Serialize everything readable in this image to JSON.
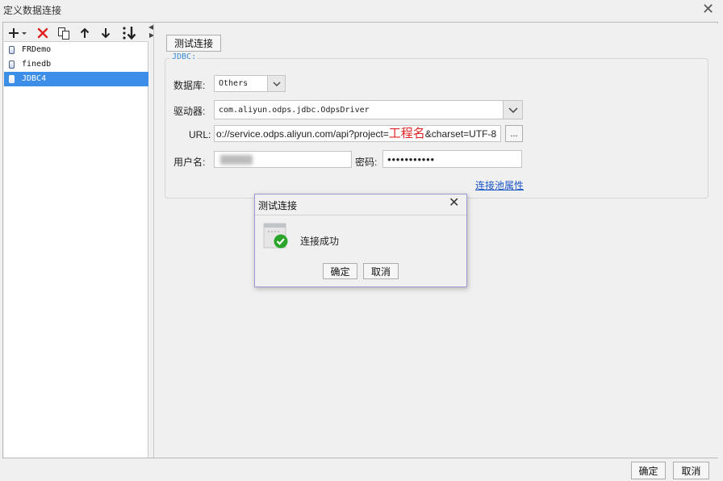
{
  "window": {
    "title": "定义数据连接",
    "close_glyph": "✕"
  },
  "toolbar": {
    "add_icon": "plus-icon",
    "delete_icon": "delete-icon",
    "copy_icon": "copy-icon",
    "up_icon": "arrow-up-icon",
    "down_icon": "arrow-down-icon",
    "sort_icon": "sort-icon",
    "accent_red": "#e02020"
  },
  "connections": {
    "items": [
      {
        "label": "FRDemo",
        "selected": false
      },
      {
        "label": "finedb",
        "selected": false
      },
      {
        "label": "JDBC4",
        "selected": true
      }
    ]
  },
  "splitter": {
    "left_glyph": "◀",
    "right_glyph": "▶"
  },
  "main": {
    "test_button": "测试连接",
    "group_label": "JDBC:",
    "database_label": "数据库:",
    "database_value": "Others",
    "driver_label": "驱动器:",
    "driver_value": "com.aliyun.odps.jdbc.OdpsDriver",
    "url_label": "URL:",
    "url_prefix": "o://service.odps.aliyun.com/api?project=",
    "url_project_annotation": "工程名",
    "url_suffix": "&charset=UTF-8",
    "url_browse": "...",
    "username_label": "用户名:",
    "username_value": "",
    "password_label": "密码:",
    "password_value": "●●●●●●●●●●●",
    "pool_link": "连接池属性"
  },
  "dialog": {
    "title": "测试连接",
    "close_glyph": "✕",
    "message": "连接成功",
    "ok": "确定",
    "cancel": "取消",
    "success_color": "#2aa52a"
  },
  "footer": {
    "ok": "确定",
    "cancel": "取消"
  }
}
